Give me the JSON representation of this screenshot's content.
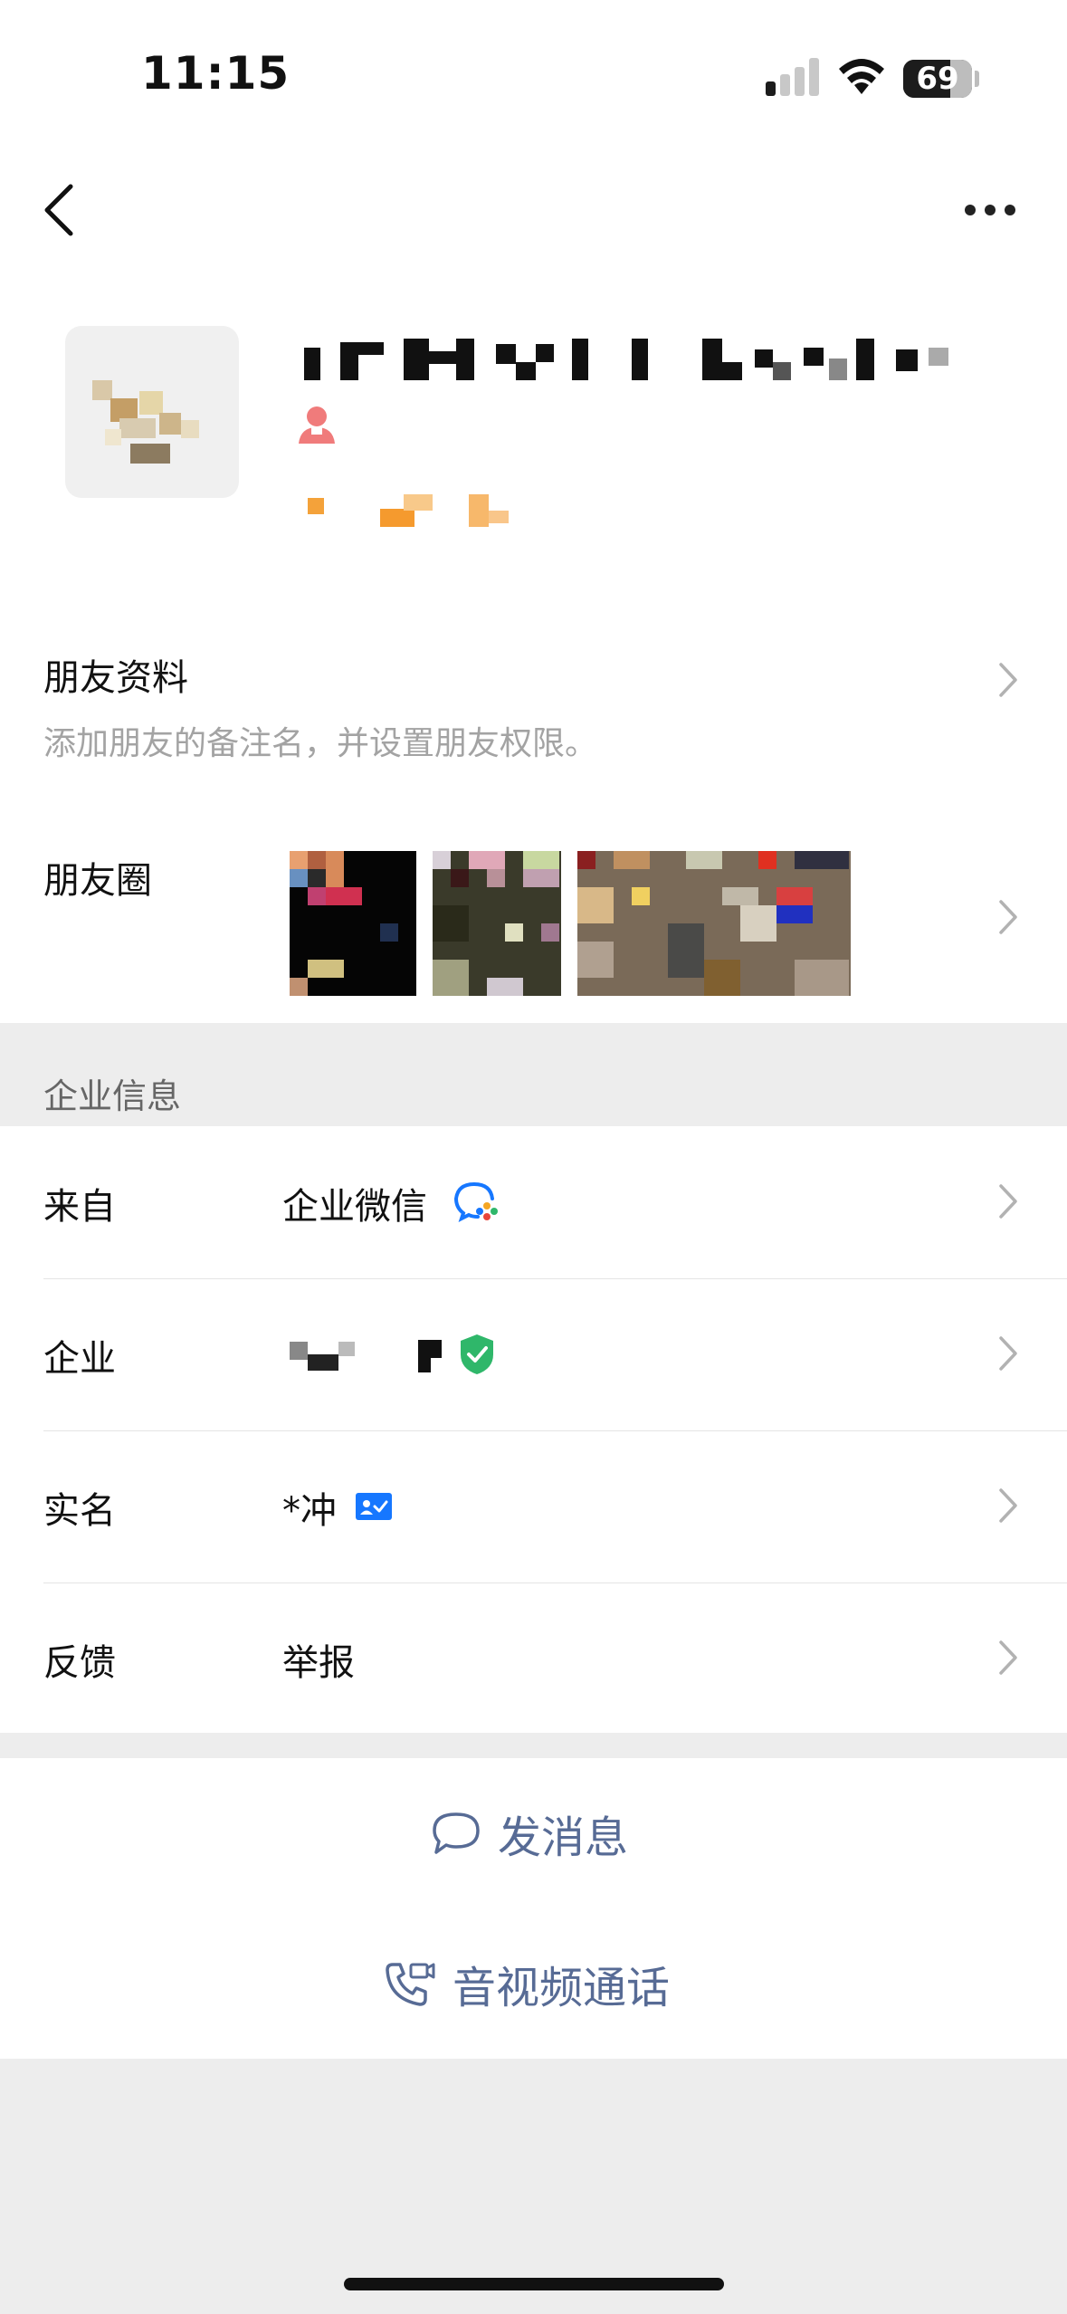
{
  "status_bar": {
    "time": "11:15",
    "battery": "69",
    "battery_level": 0.69
  },
  "nav": {
    "back_icon": "chevron-left-icon",
    "more_icon": "more-dots-icon"
  },
  "profile": {
    "gender_icon": "female-icon"
  },
  "friend_info": {
    "title": "朋友资料",
    "subtitle": "添加朋友的备注名，并设置朋友权限。"
  },
  "moments": {
    "title": "朋友圈"
  },
  "enterprise": {
    "section_title": "企业信息",
    "rows": [
      {
        "key": "来自",
        "value": "企业微信"
      },
      {
        "key": "企业",
        "value": ""
      },
      {
        "key": "实名",
        "value": "*冲"
      },
      {
        "key": "反馈",
        "value": "举报"
      }
    ]
  },
  "actions": {
    "send_message": "发消息",
    "av_call": "音视频通话"
  },
  "colors": {
    "link": "#576b95",
    "verified": "#2fb76a",
    "accent_blue": "#1677ff"
  }
}
